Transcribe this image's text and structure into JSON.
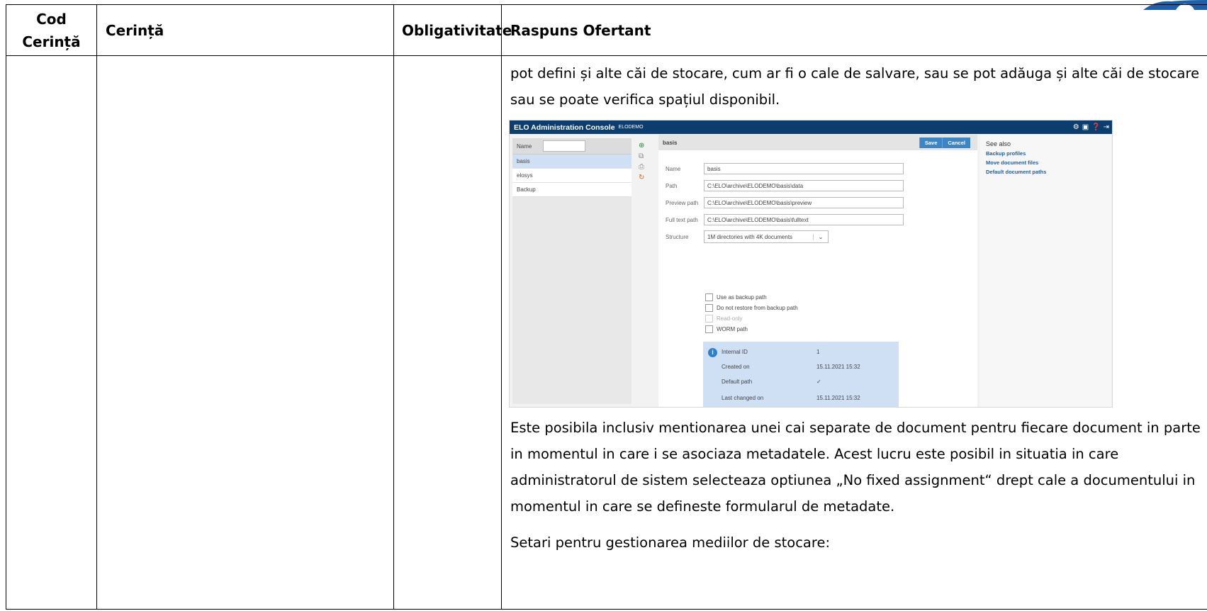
{
  "table": {
    "headers": {
      "cod": "Cod\nCerință",
      "cerinta": "Cerință",
      "obligativitate": "Obligativitate",
      "raspuns": "Raspuns Ofertant"
    }
  },
  "response": {
    "para1": "pot defini și alte căi de stocare, cum ar fi o cale de salvare, sau se pot adăuga și alte căi de stocare sau se poate verifica spațiul disponibil.",
    "para2": "Este posibila inclusiv mentionarea unei cai separate de document pentru fiecare document in parte in momentul in care i se asociaza metadatele. Acest lucru este posibil in situatia in care administratorul de sistem selecteaza optiunea „No fixed assignment“ drept cale a documentului in momentul in care se defineste formularul de metadate.",
    "para3": "Setari pentru gestionarea mediilor de stocare:"
  },
  "screenshot": {
    "title": "ELO Administration Console",
    "subtitle": "ELODEMO",
    "list_header": "Name",
    "list_items": [
      "basis",
      "elosys",
      "Backup"
    ],
    "form_title": "basis",
    "save_label": "Save",
    "cancel_label": "Cancel",
    "fields": {
      "name_label": "Name",
      "name_value": "basis",
      "path_label": "Path",
      "path_value": "C:\\ELO\\archive\\ELODEMO\\basis\\data",
      "preview_label": "Preview path",
      "preview_value": "C:\\ELO\\archive\\ELODEMO\\basis\\preview",
      "fulltext_label": "Full text path",
      "fulltext_value": "C:\\ELO\\archive\\ELODEMO\\basis\\fulltext",
      "structure_label": "Structure",
      "structure_value": "1M directories with 4K documents"
    },
    "checkboxes": [
      "Use as backup path",
      "Do not restore from backup path",
      "Read-only",
      "WORM path"
    ],
    "info": {
      "internal_id_label": "Internal ID",
      "internal_id_value": "1",
      "created_label": "Created on",
      "created_value": "15.11.2021 15:32",
      "default_label": "Default path",
      "default_value": "✓",
      "changed_label": "Last changed on",
      "changed_value": "15.11.2021 15:32"
    },
    "see_also": {
      "title": "See also",
      "links": [
        "Backup profiles",
        "Move document files",
        "Default document paths"
      ]
    }
  }
}
